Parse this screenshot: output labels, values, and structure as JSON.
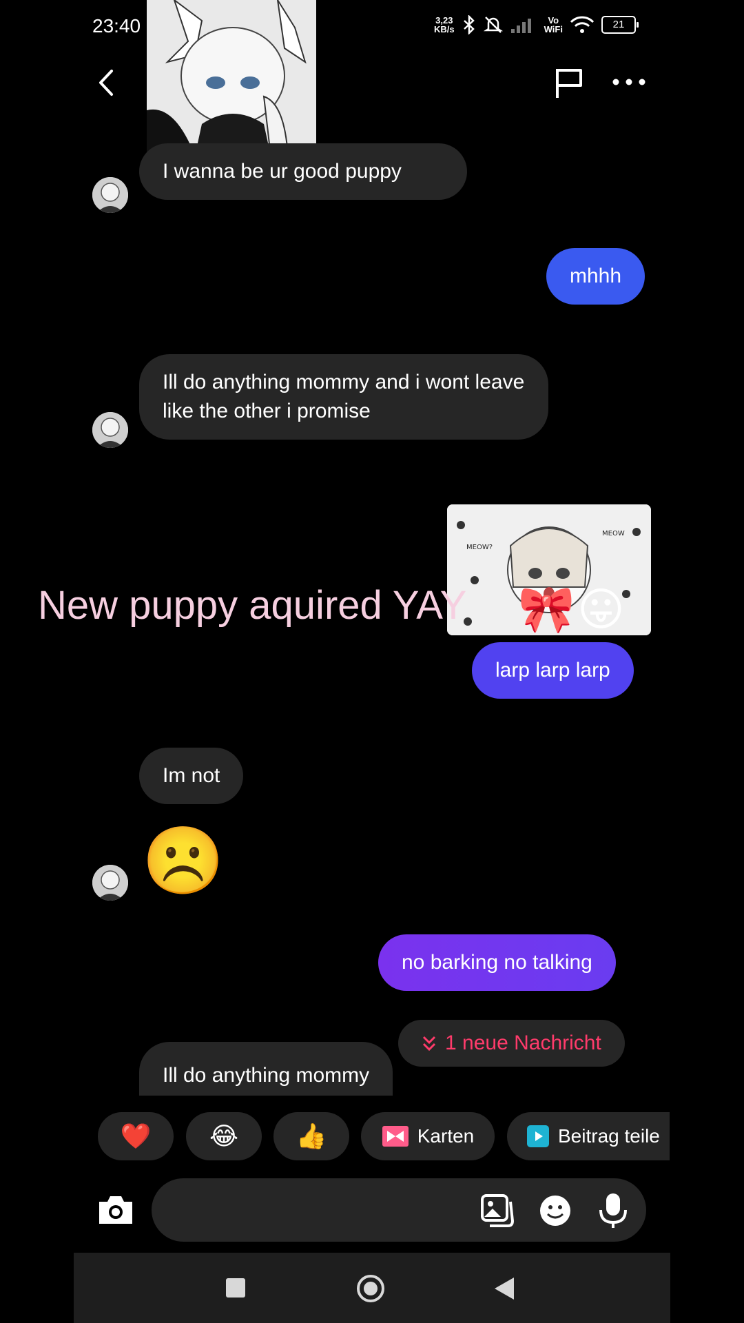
{
  "status_bar": {
    "time": "23:40",
    "net_speed_value": "3,23",
    "net_speed_unit": "KB/s",
    "vowifi_top": "Vo",
    "vowifi_bottom": "WiFi",
    "battery": "21"
  },
  "header": {
    "back_icon": "chevron-left-icon",
    "flag_icon": "flag-icon",
    "more_icon": "more-horizontal-icon"
  },
  "overlay": {
    "caption": "New puppy aquired YAY"
  },
  "messages": [
    {
      "direction": "incoming",
      "text": "I wanna be ur good puppy"
    },
    {
      "direction": "outgoing",
      "text": "mhhh",
      "color": "#3a5af0"
    },
    {
      "direction": "incoming",
      "text": "Ill do anything mommy and i wont leave like the other i promise"
    },
    {
      "direction": "outgoing",
      "text": "larp larp larp",
      "color": "#5142f0"
    },
    {
      "direction": "incoming",
      "text": "Im not"
    },
    {
      "direction": "incoming",
      "text": "☹️"
    },
    {
      "direction": "outgoing",
      "text": "no barking no talking",
      "color": "#7533f0"
    },
    {
      "direction": "incoming",
      "text": "Ill do anything mommy"
    }
  ],
  "new_message_banner": {
    "label": "1 neue Nachricht",
    "color": "#ff3b6b"
  },
  "quick_replies": [
    {
      "emoji": "❤️"
    },
    {
      "emoji": "😂"
    },
    {
      "emoji": "👍"
    },
    {
      "label": "Karten",
      "icon": "gift-card-icon"
    },
    {
      "label": "Beitrag teile",
      "icon": "share-post-icon"
    }
  ],
  "composer": {
    "placeholder": ""
  }
}
